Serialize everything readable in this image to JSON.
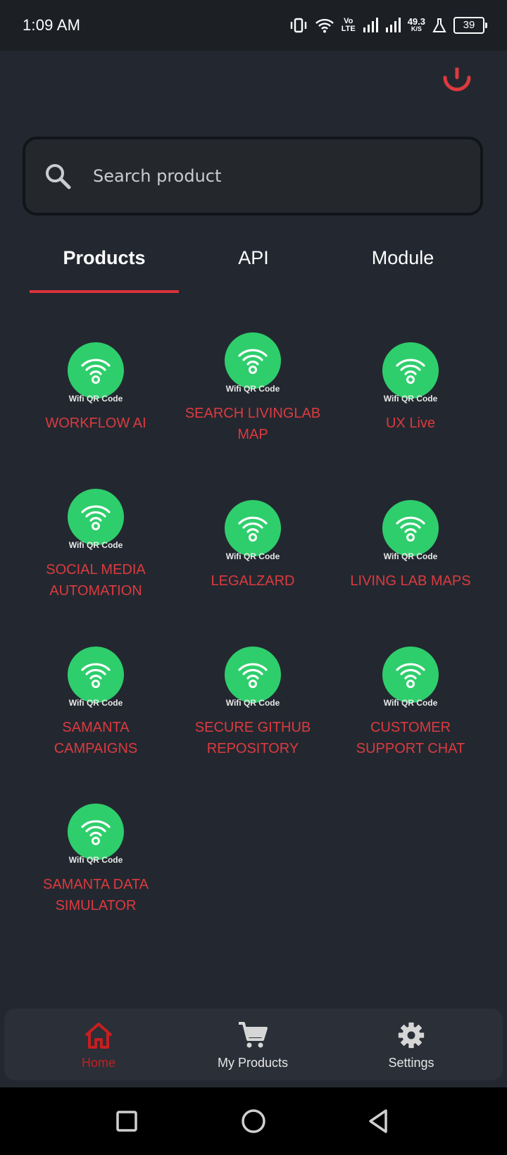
{
  "status_bar": {
    "time": "1:09 AM",
    "net_speed_value": "49.3",
    "net_speed_unit": "K/S",
    "volte": "Vo",
    "lte": "LTE",
    "battery": "39"
  },
  "search": {
    "placeholder": "Search product"
  },
  "tabs": [
    {
      "label": "Products",
      "active": true
    },
    {
      "label": "API",
      "active": false
    },
    {
      "label": "Module",
      "active": false
    }
  ],
  "product_icon_caption": "Wifi QR Code",
  "products": [
    {
      "name": "WORKFLOW AI"
    },
    {
      "name": "SEARCH LIVINGLAB MAP"
    },
    {
      "name": "UX Live"
    },
    {
      "name": "SOCIAL MEDIA AUTOMATION"
    },
    {
      "name": "LEGALZARD"
    },
    {
      "name": "LIVING LAB MAPS"
    },
    {
      "name": "SAMANTA CAMPAIGNS"
    },
    {
      "name": "SECURE GITHUB REPOSITORY"
    },
    {
      "name": "CUSTOMER SUPPORT CHAT"
    },
    {
      "name": "SAMANTA DATA SIMULATOR"
    }
  ],
  "bottom_nav": {
    "home": "Home",
    "my_products": "My Products",
    "settings": "Settings"
  },
  "colors": {
    "accent_red": "#dc3a3f",
    "icon_green": "#2fce6c",
    "background": "#232830"
  }
}
